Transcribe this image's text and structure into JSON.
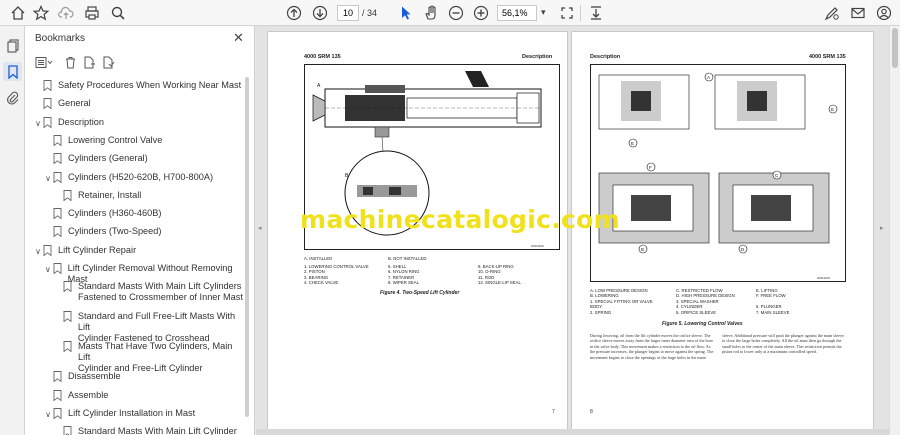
{
  "toolbar": {
    "page_current": "10",
    "page_total": "/ 34",
    "zoom": "56,1%",
    "zoom_caret": "▾"
  },
  "bookmarks": {
    "title": "Bookmarks",
    "items": [
      {
        "label": "Safety Procedures When Working Near Mast",
        "level": 1,
        "toggle": ""
      },
      {
        "label": "General",
        "level": 1,
        "toggle": ""
      },
      {
        "label": "Description",
        "level": 1,
        "toggle": "∨"
      },
      {
        "label": "Lowering Control Valve",
        "level": 2,
        "toggle": ""
      },
      {
        "label": "Cylinders (General)",
        "level": 2,
        "toggle": ""
      },
      {
        "label": "Cylinders (H520-620B, H700-800A)",
        "level": 2,
        "toggle": "∨"
      },
      {
        "label": "Retainer, Install",
        "level": 3,
        "toggle": ""
      },
      {
        "label": "Cylinders (H360-460B)",
        "level": 2,
        "toggle": ""
      },
      {
        "label": "Cylinders (Two-Speed)",
        "level": 2,
        "toggle": ""
      },
      {
        "label": "Lift Cylinder Repair",
        "level": 1,
        "toggle": "∨"
      },
      {
        "label": "Lift Cylinder Removal Without Removing Mast",
        "level": 2,
        "toggle": "∨"
      },
      {
        "label": "Standard Masts With Main Lift Cylinders Fastened to Crossmember of Inner Mast",
        "level": 3,
        "toggle": "",
        "lines": [
          "Standard Masts With Main Lift Cylinders",
          "Fastened to Crossmember of Inner Mast"
        ]
      },
      {
        "label": "Standard and Full Free-Lift Masts With Lift Cylinder Fastened to Crosshead",
        "level": 3,
        "toggle": "",
        "lines": [
          "Standard and Full Free-Lift Masts With Lift",
          "Cylinder Fastened to Crosshead"
        ]
      },
      {
        "label": "Masts That Have Two Cylinders, Main Lift Cylinder and Free-Lift Cylinder",
        "level": 3,
        "toggle": "",
        "lines": [
          "Masts That Have Two Cylinders, Main Lift",
          "Cylinder and Free-Lift Cylinder"
        ]
      },
      {
        "label": "Disassemble",
        "level": 2,
        "toggle": ""
      },
      {
        "label": "Assemble",
        "level": 2,
        "toggle": ""
      },
      {
        "label": "Lift Cylinder Installation in Mast",
        "level": 2,
        "toggle": "∨"
      },
      {
        "label": "Standard Masts With Main Lift Cylinder",
        "level": 3,
        "toggle": ""
      }
    ]
  },
  "page7": {
    "header": "4000 SRM 135",
    "header_right": "Description",
    "legend_a": "A.  INSTALLED",
    "legend_b": "B.  NOT INSTALLED",
    "legend_col1": [
      "1.  LOWERING CONTROL VALVE",
      "2.  PISTON",
      "3.  BEARING",
      "4.  CHECK VALVE"
    ],
    "legend_col2": [
      "5.  SHELL",
      "6.  NYLON RING",
      "7.  RETAINER",
      "8.  WIPER SEAL"
    ],
    "legend_col3": [
      "9.  BACK-UP RING",
      "10. O-RING",
      "11. ROD",
      "12. SINGLE-LIP SEAL"
    ],
    "caption": "Figure 4.  Two-Speed Lift Cylinder",
    "page_number": "7"
  },
  "page8": {
    "header": "Description",
    "header_right": "4000 SRM 135",
    "legend_col1": [
      "A.  LOW PRESSURE DESIGN",
      "B.  LOWERING",
      "1.  SPECIAL FITTING OR VALVE",
      "     BODY",
      "2.  SPRING"
    ],
    "legend_col2": [
      "C.  RESTRICTED FLOW",
      "D.  HIGH PRESSURE DESIGN",
      "3.  SPECIAL WASHER",
      "4.  CYLINDER",
      "5.  ORIFICE SLEEVE"
    ],
    "legend_col3": [
      "E.  LIFTING",
      "F.  FREE FLOW",
      "",
      "6.  PLUNGER",
      "7.  MAIN SLEEVE"
    ],
    "caption": "Figure 5.  Lowering Control Valves",
    "body_left": "During lowering, oil from the lift cylinder moves the orifice sleeve. The orifice sleeve moves away from the larger inner diameter area of the bore in the valve body. This movement makes a restriction to the oil flow. As the pressure increases, the plunger begins to move against the spring. The movement begins to close the openings of the large holes in the main",
    "body_right": "sleeve. Additional pressure will push the plunger against the main sleeve to close the large holes completely. All the oil must then go through the small holes to the center of the main sleeve. This restriction permits the piston rod to lower only at a maximum controlled speed.",
    "page_number": "8"
  },
  "watermark": "machinecatalogic.com",
  "colors": {
    "watermark": "#f1e11d",
    "toolbar_bg": "#f7f7f7",
    "select_tool": "#1a5fd8"
  }
}
